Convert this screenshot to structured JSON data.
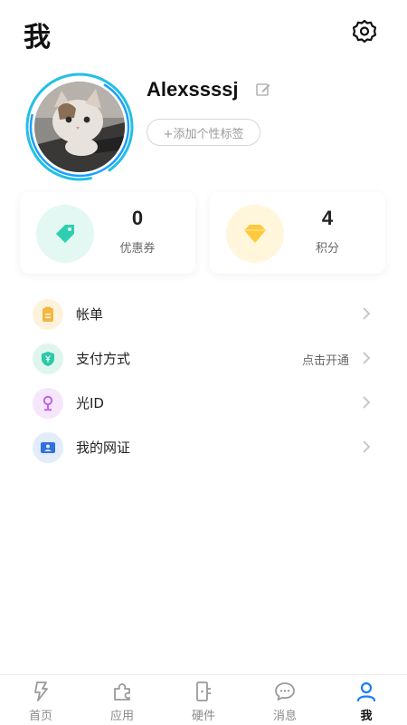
{
  "header": {
    "title": "我"
  },
  "profile": {
    "username": "Alexssssj",
    "tag_button": "+添加个性标签"
  },
  "stats": [
    {
      "value": "0",
      "label": "优惠券",
      "icon": "coupon-tag-icon",
      "color": "#2ecfb0"
    },
    {
      "value": "4",
      "label": "积分",
      "icon": "diamond-icon",
      "color": "#ffc93c"
    }
  ],
  "menu": [
    {
      "label": "帐单",
      "hint": "",
      "icon": "bill-icon",
      "color": "#f3b63f"
    },
    {
      "label": "支付方式",
      "hint": "点击开通",
      "icon": "shield-yen-icon",
      "color": "#2ec8a6"
    },
    {
      "label": "光ID",
      "hint": "",
      "icon": "location-person-icon",
      "color": "#c55fe6"
    },
    {
      "label": "我的网证",
      "hint": "",
      "icon": "id-card-icon",
      "color": "#2f6fe0"
    }
  ],
  "tabs": [
    {
      "label": "首页",
      "icon": "home-bolt-icon",
      "active": false
    },
    {
      "label": "应用",
      "icon": "puzzle-icon",
      "active": false
    },
    {
      "label": "硬件",
      "icon": "device-icon",
      "active": false
    },
    {
      "label": "消息",
      "icon": "message-icon",
      "active": false
    },
    {
      "label": "我",
      "icon": "person-icon",
      "active": true
    }
  ],
  "colors": {
    "accent": "#1a9fff",
    "active_tab": "#1a7bff",
    "ring": "#22bfe6"
  }
}
